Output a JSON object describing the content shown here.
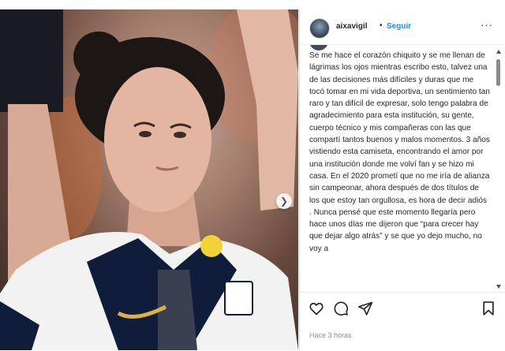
{
  "post": {
    "username": "aixavigil",
    "separator": "•",
    "follow_label": "Seguir",
    "more_label": "···",
    "caption": "Se me hace el corazón chiquito y se me llenan de lágrimas los ojos mientras escribo esto, talvez una de las decisiones más difíciles y duras que me tocó tomar en mi vida deportiva, un sentimiento tan raro y tan difícil de expresar, solo tengo palabra de agradecimiento para esta institución, su gente, cuerpo técnico y mis compañeras con las que compartí tantos buenos y malos momentos. 3 años vistiendo esta camiseta, encontrando el amor por una institución donde me volví fan y se hizo mi casa. En el 2020 prometí que no me iría de alianza sin campeonar, ahora después de dos títulos de los que estoy tan orgullosa, es hora de decir adiós . Nunca pensé que este momento llegaría pero hace unos días me dijeron que “para crecer hay que dejar algo atrás” y se que yo dejo mucho, no voy a",
    "timestamp": "Hace 3 horas"
  },
  "colors": {
    "link": "#0095f6",
    "text": "#262626",
    "muted": "#8e8e8e",
    "border": "#dbdbdb"
  },
  "icons": {
    "like": "heart-icon",
    "comment": "comment-icon",
    "share": "share-icon",
    "save": "bookmark-icon",
    "next": "chevron-right-icon"
  }
}
